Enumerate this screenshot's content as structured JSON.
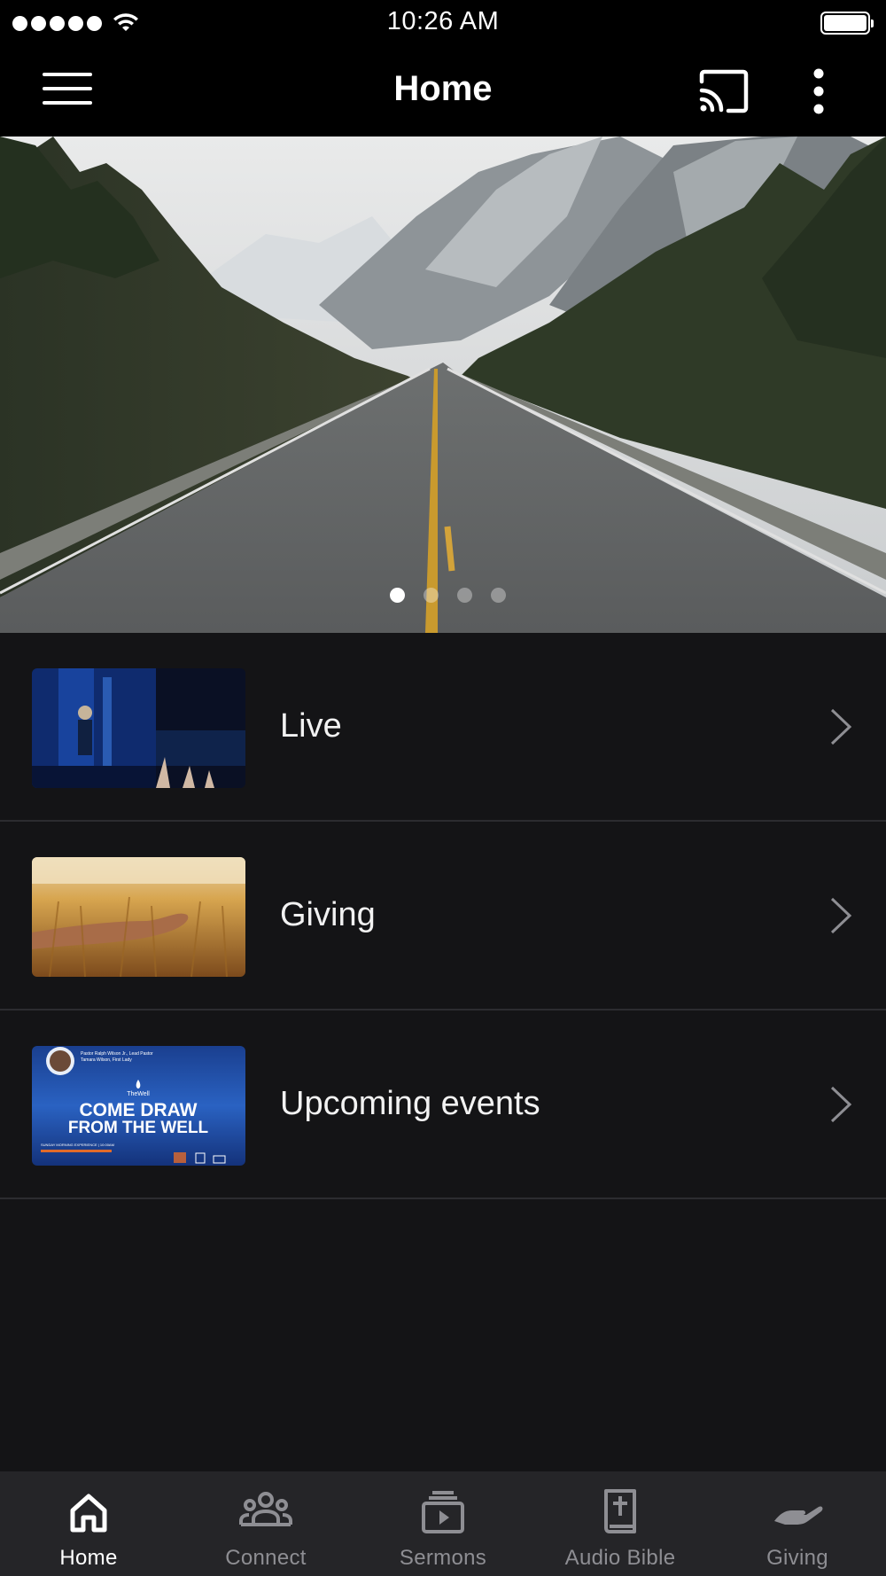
{
  "status_bar": {
    "time": "10:26 AM",
    "signal_icon": "signal-dots-icon",
    "wifi_icon": "wifi-icon",
    "battery_icon": "battery-icon",
    "battery_level": 1.0
  },
  "app_bar": {
    "title": "Home",
    "menu_icon": "hamburger-menu-icon",
    "cast_icon": "cast-icon",
    "more_icon": "more-vertical-icon"
  },
  "hero": {
    "image": "mountain-road-photo",
    "slide_count": 4,
    "active_slide": 1
  },
  "list": {
    "items": [
      {
        "label": "Live",
        "thumbnail": "concert-worship-photo"
      },
      {
        "label": "Giving",
        "thumbnail": "wheat-field-hand-photo"
      },
      {
        "label": "Upcoming events",
        "thumbnail": "the-well-event-flyer",
        "flyer_text": {
          "pastor_line": "Pastor Ralph Wilson Jr., Lead Pastor",
          "lady_line": "Tamara Wilson, First Lady",
          "brand": "TheWell",
          "headline_1": "COME DRAW",
          "headline_2": "FROM THE WELL",
          "footer": "SUNDAY MORNING EXPERIENCE | 10:00AM"
        }
      }
    ],
    "chevron_icon": "chevron-right-icon"
  },
  "tab_bar": {
    "tabs": [
      {
        "label": "Home",
        "icon": "home-icon",
        "active": true
      },
      {
        "label": "Connect",
        "icon": "group-icon",
        "active": false
      },
      {
        "label": "Sermons",
        "icon": "video-library-icon",
        "active": false
      },
      {
        "label": "Audio Bible",
        "icon": "bible-icon",
        "active": false
      },
      {
        "label": "Giving",
        "icon": "giving-hand-icon",
        "active": false
      }
    ]
  },
  "colors": {
    "background": "#141416",
    "app_bar": "#000000",
    "tab_bar": "#252528",
    "divider": "#2c2c30",
    "inactive": "#8e8e93",
    "active": "#ffffff"
  }
}
